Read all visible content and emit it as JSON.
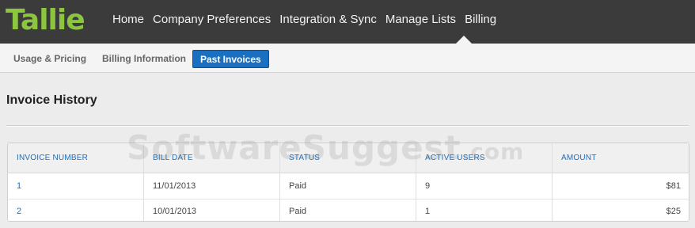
{
  "brand": {
    "logo_text": "Tallie",
    "logo_color": "#8cc63f"
  },
  "nav": {
    "items": [
      {
        "label": "Home"
      },
      {
        "label": "Company Preferences"
      },
      {
        "label": "Integration & Sync"
      },
      {
        "label": "Manage Lists"
      },
      {
        "label": "Billing"
      }
    ],
    "active_item": "Billing"
  },
  "subnav": {
    "items": [
      {
        "label": "Usage & Pricing"
      },
      {
        "label": "Billing Information"
      },
      {
        "label": "Past Invoices"
      }
    ],
    "active_item": "Past Invoices",
    "accent_color": "#1a6fc0"
  },
  "page": {
    "title": "Invoice History"
  },
  "invoice_table": {
    "columns": [
      "INVOICE NUMBER",
      "BILL DATE",
      "STATUS",
      "ACTIVE USERS",
      "AMOUNT"
    ],
    "rows": [
      [
        "1",
        "11/01/2013",
        "Paid",
        "9",
        "$81"
      ],
      [
        "2",
        "10/01/2013",
        "Paid",
        "1",
        "$25"
      ]
    ]
  },
  "watermark": {
    "text": "SoftwareSuggest",
    "suffix": ".com"
  }
}
